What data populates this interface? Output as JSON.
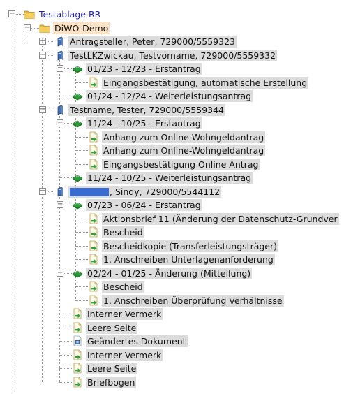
{
  "tree": {
    "root": {
      "label": "Testablage RR",
      "icon": "folder-icon",
      "expander": "−"
    },
    "folder": {
      "label": "DiWO-Demo",
      "icon": "folder-icon",
      "expander": "−"
    },
    "persons": [
      {
        "label": "Antragsteller, Peter, 729000/5559323",
        "expander": "+"
      },
      {
        "label": "TestLKZwickau, Testvorname, 729000/5559332",
        "expander": "−"
      },
      {
        "label": "Testname, Tester, 729000/5559344",
        "expander": "−"
      },
      {
        "label": ", Sindy, 729000/5544112",
        "expander": "−",
        "redacted": true
      }
    ],
    "cases": [
      {
        "label": "01/23 - 12/23 - Erstantrag",
        "expander": "−"
      },
      {
        "label": "01/24 - 12/24 - Weiterleistungsantrag"
      },
      {
        "label": "11/24 - 10/25 - Erstantrag",
        "expander": "−"
      },
      {
        "label": "11/24 - 10/25 - Weiterleistungsantrag"
      },
      {
        "label": "07/23 - 06/24 - Erstantrag",
        "expander": "−"
      },
      {
        "label": "02/24 - 01/25 - Änderung (Mitteilung)",
        "expander": "−"
      }
    ],
    "documents": [
      {
        "label": "Eingangsbestätigung, automatische Erstellung"
      },
      {
        "label": "Anhang zum Online-Wohngeldantrag"
      },
      {
        "label": "Anhang zum Online-Wohngeldantrag"
      },
      {
        "label": "Eingangsbestätigung Online Antrag"
      },
      {
        "label": "Aktionsbrief 11 (Änderung der Datenschutz-Grundver"
      },
      {
        "label": "Bescheid"
      },
      {
        "label": "Bescheidkopie (Transferleistungsträger)"
      },
      {
        "label": "1. Anschreiben Unterlagenanforderung"
      },
      {
        "label": "Bescheid"
      },
      {
        "label": "1. Anschreiben Überprüfung Verhältnisse"
      },
      {
        "label": "Interner Vermerk"
      },
      {
        "label": "Leere Seite"
      },
      {
        "label": "Geändertes Dokument",
        "icon": "blue-document-icon"
      },
      {
        "label": "Interner Vermerk"
      },
      {
        "label": "Leere Seite"
      },
      {
        "label": "Briefbogen"
      }
    ]
  }
}
